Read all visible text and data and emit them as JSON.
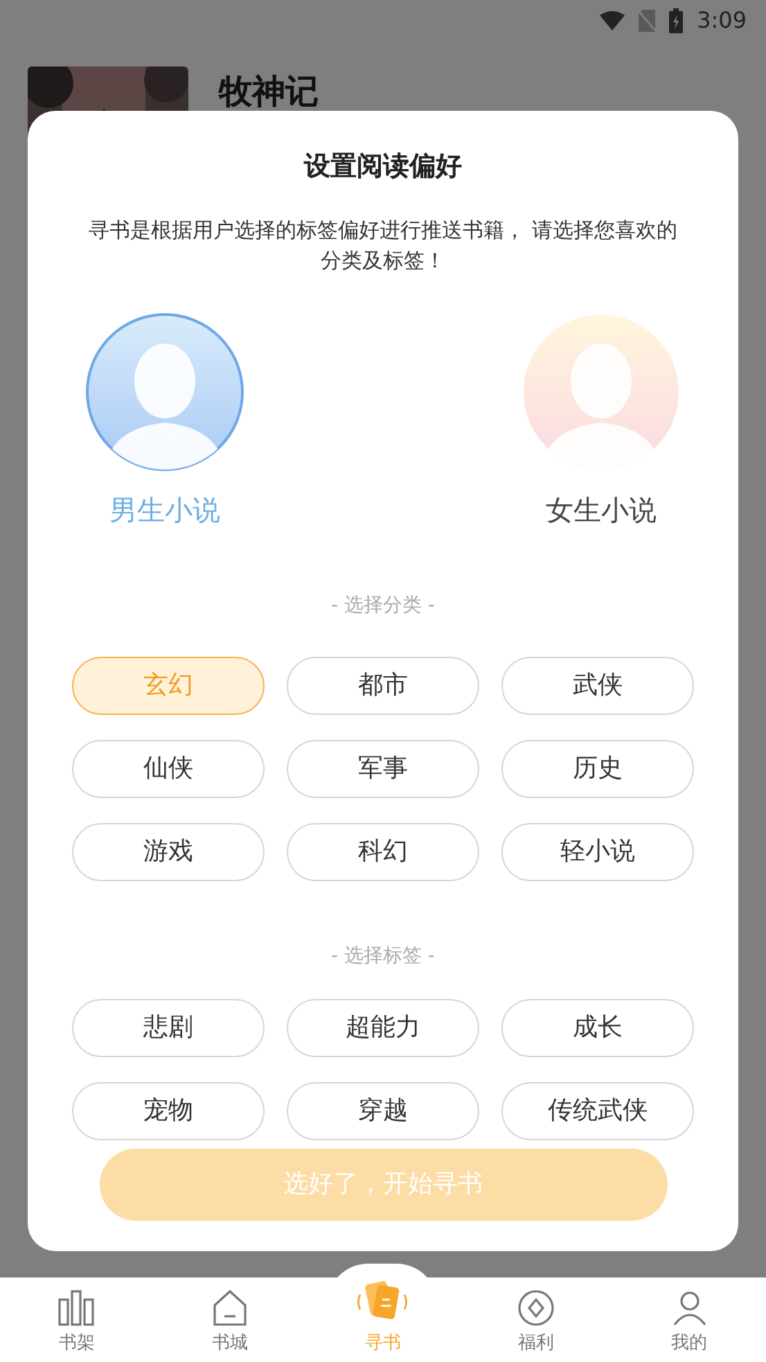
{
  "status_bar": {
    "time": "3:09"
  },
  "background": {
    "book_title": "牧神记"
  },
  "dialog": {
    "title": "设置阅读偏好",
    "description": "寻书是根据用户选择的标签偏好进行推送书籍， 请选择您喜欢的分类及标签！",
    "genders": [
      {
        "kind": "male",
        "label": "男生小说",
        "selected": true
      },
      {
        "kind": "female",
        "label": "女生小说",
        "selected": false
      }
    ],
    "category_heading": "- 选择分类 -",
    "categories": [
      {
        "label": "玄幻",
        "selected": true
      },
      {
        "label": "都市",
        "selected": false
      },
      {
        "label": "武侠",
        "selected": false
      },
      {
        "label": "仙侠",
        "selected": false
      },
      {
        "label": "军事",
        "selected": false
      },
      {
        "label": "历史",
        "selected": false
      },
      {
        "label": "游戏",
        "selected": false
      },
      {
        "label": "科幻",
        "selected": false
      },
      {
        "label": "轻小说",
        "selected": false
      }
    ],
    "tag_heading": "- 选择标签 -",
    "tags": [
      {
        "label": "悲剧",
        "selected": false
      },
      {
        "label": "超能力",
        "selected": false
      },
      {
        "label": "成长",
        "selected": false
      },
      {
        "label": "宠物",
        "selected": false
      },
      {
        "label": "穿越",
        "selected": false
      },
      {
        "label": "传统武侠",
        "selected": false
      }
    ],
    "confirm_button": {
      "label": "选好了，开始寻书",
      "disabled": true
    }
  },
  "bottom_nav": [
    {
      "kind": "shelf",
      "label": "书架",
      "selected": false
    },
    {
      "kind": "store",
      "label": "书城",
      "selected": false
    },
    {
      "kind": "find",
      "label": "寻书",
      "selected": true
    },
    {
      "kind": "gift",
      "label": "福利",
      "selected": false
    },
    {
      "kind": "me",
      "label": "我的",
      "selected": false
    }
  ]
}
